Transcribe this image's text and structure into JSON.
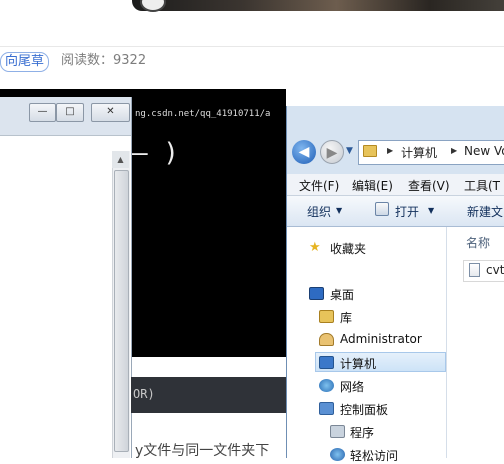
{
  "article": {
    "author_tag": "向尾草",
    "read_count": "阅读数：9322",
    "code_bar_text": "OR)",
    "snippet": "y文件与同一文件夹下"
  },
  "terminal": {
    "url_fragment": "ng.csdn.net/qq_41910711/a",
    "paren": "— )"
  },
  "left_window": {
    "minimize_glyph": "—",
    "maximize_glyph": "□",
    "close_glyph": "✕",
    "scroll_up_glyph": "▲"
  },
  "explorer": {
    "back_glyph": "◀",
    "forward_glyph": "▶",
    "dropdown_glyph": "▼",
    "address": {
      "separator": "▶",
      "segments": [
        "计算机",
        "New Vo"
      ]
    },
    "menu": {
      "file": "文件(F)",
      "edit": "编辑(E)",
      "view": "查看(V)",
      "tools": "工具(T"
    },
    "commands": {
      "organize": "组织",
      "open": "打开",
      "new_folder": "新建文",
      "caret": "▼"
    },
    "nav": {
      "favorites_glyph": "★",
      "favorites": "收藏夹",
      "desktop": "桌面",
      "library": "库",
      "administrator": "Administrator",
      "computer": "计算机",
      "network": "网络",
      "control_panel": "控制面板",
      "programs": "程序",
      "accessibility": "轻松访问"
    },
    "files": {
      "column_name": "名称",
      "items": [
        {
          "name": "cvt"
        }
      ]
    }
  }
}
